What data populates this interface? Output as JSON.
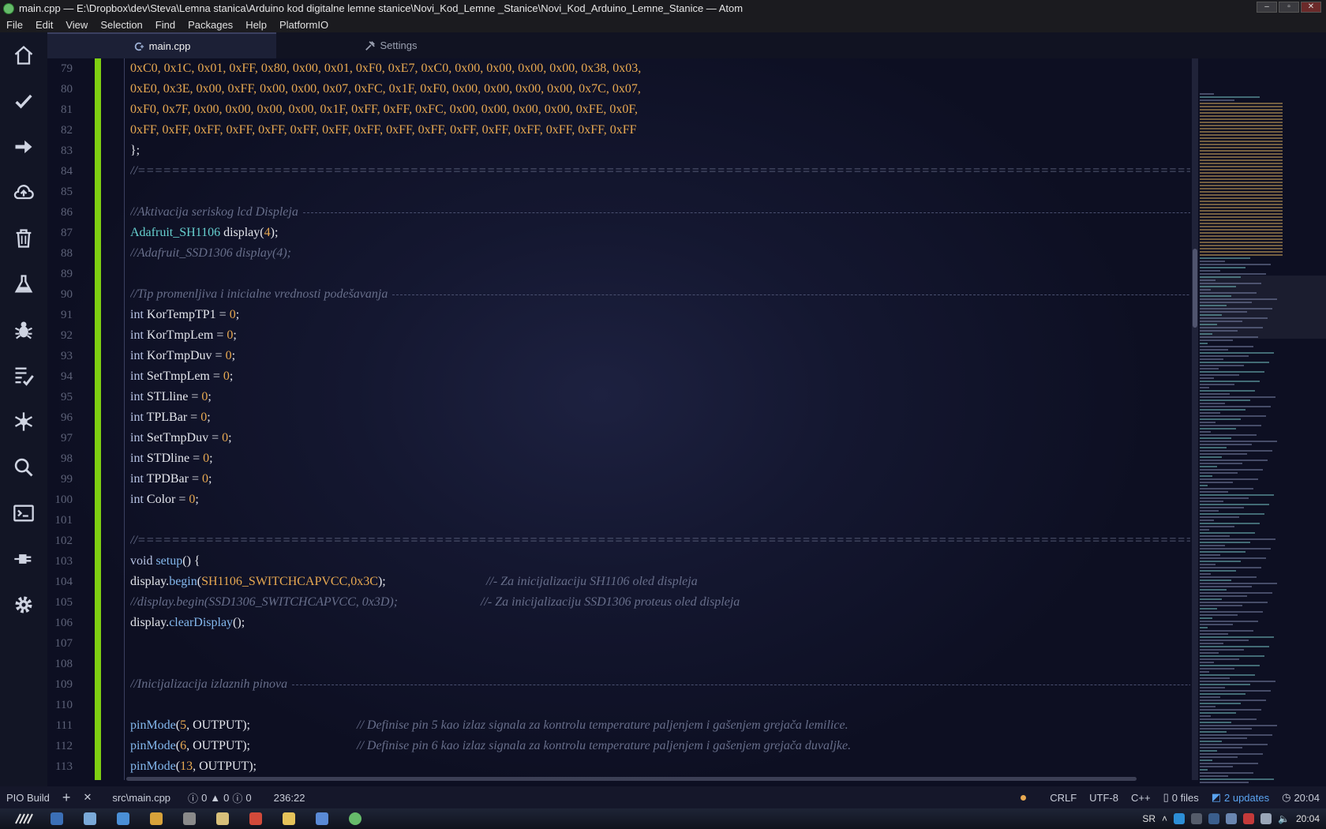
{
  "window": {
    "title": "main.cpp — E:\\Dropbox\\dev\\Steva\\Lemna stanica\\Arduino kod digitalne lemne stanice\\Novi_Kod_Lemne _Stanice\\Novi_Kod_Arduino_Lemne_Stanice — Atom",
    "controls": [
      "–",
      "▫",
      "✕"
    ]
  },
  "menu": [
    "File",
    "Edit",
    "View",
    "Selection",
    "Find",
    "Packages",
    "Help",
    "PlatformIO"
  ],
  "dock": [
    "home-icon",
    "check-icon",
    "arrow-right-icon",
    "cloud-upload-icon",
    "trash-icon",
    "flask-icon",
    "bug-icon",
    "checklist-icon",
    "snowflake-icon",
    "search-icon",
    "terminal-icon",
    "plug-icon",
    "gear-icon"
  ],
  "tabs": [
    {
      "label": "main.cpp",
      "active": true,
      "icon": "cpp-file-icon"
    },
    {
      "label": "Settings",
      "active": false,
      "icon": "tools-icon"
    }
  ],
  "editor": {
    "line_numbers": [
      "79",
      "80",
      "81",
      "82",
      "83",
      "84",
      "85",
      "86",
      "87",
      "88",
      "89",
      "90",
      "91",
      "92",
      "93",
      "94",
      "95",
      "96",
      "97",
      "98",
      "99",
      "100",
      "101",
      "102",
      "103",
      "104",
      "105",
      "106",
      "107",
      "108",
      "109",
      "110",
      "111",
      "112",
      "113"
    ],
    "lines": [
      {
        "type": "hex",
        "text": "0xC0, 0x1C, 0x01, 0xFF, 0x80, 0x00, 0x01, 0xF0, 0xE7, 0xC0, 0x00, 0x00, 0x00, 0x00, 0x38, 0x03,"
      },
      {
        "type": "hex",
        "text": "0xE0, 0x3E, 0x00, 0xFF, 0x00, 0x00, 0x07, 0xFC, 0x1F, 0xF0, 0x00, 0x00, 0x00, 0x00, 0x7C, 0x07,"
      },
      {
        "type": "hex",
        "text": "0xF0, 0x7F, 0x00, 0x00, 0x00, 0x00, 0x1F, 0xFF, 0xFF, 0xFC, 0x00, 0x00, 0x00, 0x00, 0xFE, 0x0F,"
      },
      {
        "type": "hex",
        "text": "0xFF, 0xFF, 0xFF, 0xFF, 0xFF, 0xFF, 0xFF, 0xFF, 0xFF, 0xFF, 0xFF, 0xFF, 0xFF, 0xFF, 0xFF, 0xFF"
      },
      {
        "type": "txt",
        "text": "};"
      },
      {
        "type": "rule",
        "text": "//=================================================================================================================================="
      },
      {
        "type": "blank",
        "text": ""
      },
      {
        "type": "section",
        "text": "//Aktivacija seriskog lcd Displeja"
      },
      {
        "type": "decl",
        "cls": "Adafruit_SH1106",
        "rest": " display(",
        "num": "4",
        "end": ");"
      },
      {
        "type": "cmt",
        "text": "//Adafruit_SSD1306 display(4);"
      },
      {
        "type": "blank",
        "text": ""
      },
      {
        "type": "section",
        "text": "//Tip promenljiva i inicialne vrednosti podešavanja"
      },
      {
        "type": "int",
        "name": "KorTempTP1"
      },
      {
        "type": "int",
        "name": "KorTmpLem"
      },
      {
        "type": "int",
        "name": "KorTmpDuv"
      },
      {
        "type": "int",
        "name": "SetTmpLem"
      },
      {
        "type": "int",
        "name": "STLline"
      },
      {
        "type": "int",
        "name": "TPLBar"
      },
      {
        "type": "int",
        "name": "SetTmpDuv"
      },
      {
        "type": "int",
        "name": "STDline"
      },
      {
        "type": "int",
        "name": "TPDBar"
      },
      {
        "type": "int",
        "name": "Color"
      },
      {
        "type": "blank",
        "text": ""
      },
      {
        "type": "rule",
        "text": "//=================================================================================================================================="
      },
      {
        "type": "setup",
        "text": "void setup() {"
      },
      {
        "type": "begin",
        "text": "display.begin(SH1106_SWITCHCAPVCC,0x3C);",
        "comment": "//- Za inicijalizaciju SH1106 oled displeja"
      },
      {
        "type": "begin_cmt",
        "text": "//display.begin(SSD1306_SWITCHCAPVCC, 0x3D);",
        "comment": "//- Za inicijalizaciju SSD1306 proteus oled displeja"
      },
      {
        "type": "clear",
        "text": "display.clearDisplay();"
      },
      {
        "type": "blank",
        "text": ""
      },
      {
        "type": "blank",
        "text": ""
      },
      {
        "type": "section",
        "text": "//Inicijalizacija izlaznih pinova"
      },
      {
        "type": "blank",
        "text": ""
      },
      {
        "type": "pin",
        "pin": "5",
        "comment": "// Definise pin 5 kao izlaz signala za kontrolu temperature paljenjem i gašenjem grejača lemilice."
      },
      {
        "type": "pin",
        "pin": "6",
        "comment": "// Definise pin 6 kao izlaz signala za kontrolu temperature paljenjem i gašenjem grejača duvaljke."
      },
      {
        "type": "pin",
        "pin": "13",
        "comment": ""
      }
    ]
  },
  "status": {
    "build": "PIO Build",
    "add": "+",
    "close": "✕",
    "file": "src\\main.cpp",
    "errors": "0",
    "warnings": "0",
    "infos": "0",
    "cursor": "236:22",
    "line_ending": "CRLF",
    "encoding": "UTF-8",
    "grammar": "C++",
    "files": "0 files",
    "updates": "2 updates",
    "clock": "20:04"
  },
  "taskbar": {
    "lang": "SR",
    "time": "20:04",
    "icon_colors": [
      "#3b6fb6",
      "#7aa9d8",
      "#4a8fd6",
      "#d8a23a",
      "#8a8a8a",
      "#d8c07a",
      "#d24a3a",
      "#e6c35a",
      "#5a8ad6",
      "#66bb6a"
    ]
  },
  "colors": {
    "git_added": "#7ecf12",
    "accent_blue": "#5aa3f0",
    "hex_literal": "#e8a951"
  }
}
